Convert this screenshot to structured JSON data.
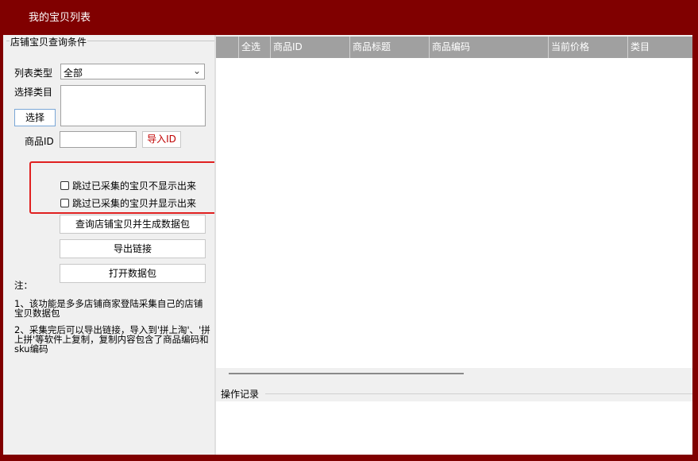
{
  "window": {
    "title": "我的宝贝列表"
  },
  "query": {
    "group_title": "店铺宝贝查询条件",
    "list_type_label": "列表类型",
    "list_type_value": "全部",
    "category_label": "选择类目",
    "select_button": "选择",
    "product_id_label": "商品ID",
    "product_id_value": "",
    "import_id_button": "导入ID",
    "skip_hide_label": "跳过已采集的宝贝不显示出来",
    "skip_show_label": "跳过已采集的宝贝并显示出来",
    "query_button": "查询店铺宝贝并生成数据包",
    "export_button": "导出链接",
    "open_button": "打开数据包"
  },
  "notes": {
    "title": "注：",
    "line1": "1、该功能是多多店铺商家登陆采集自己的店铺宝贝数据包",
    "line2": "2、采集完后可以导出链接，导入到'拼上淘'、'拼上拼'等软件上复制，复制内容包含了商品编码和sku编码"
  },
  "grid": {
    "columns": [
      "",
      "全选",
      "商品ID",
      "商品标题",
      "商品编码",
      "当前价格",
      "类目"
    ]
  },
  "log": {
    "title": "操作记录"
  }
}
